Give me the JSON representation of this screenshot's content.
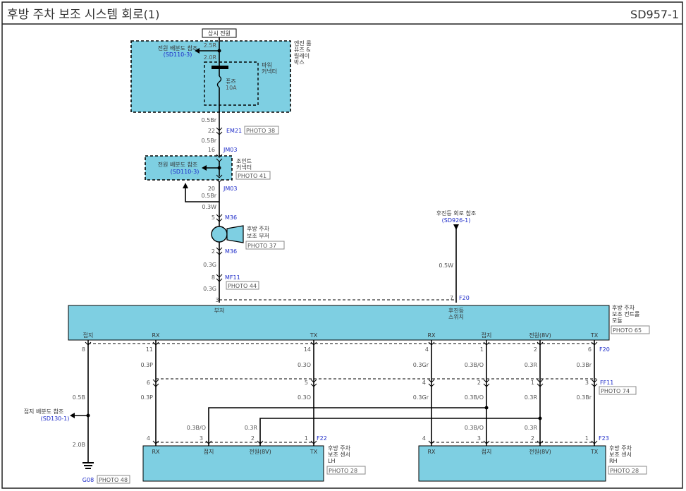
{
  "header": {
    "title": "후방 주차 보조 시스템 회로",
    "title_num": "(1)",
    "code": "SD957-1"
  },
  "top_label": "상시 전원",
  "ejb": {
    "label_lines": [
      "엔진 룸",
      "퓨즈 &",
      "릴레이",
      "박스"
    ],
    "ref_text": "전원 배분도 참조",
    "ref_code": "(SD110-3)",
    "connector_lines": [
      "파워",
      "커넥터"
    ],
    "fuse_lines": [
      "퓨즈",
      "10A"
    ],
    "wire1": "2.5R",
    "wire2": "2.0R"
  },
  "em21": {
    "wire_above": "0.5Br",
    "pin": "22",
    "code": "EM21",
    "photo": "PHOTO 38",
    "wire_below": "0.5Br"
  },
  "jm03": {
    "pin_top": "16",
    "code_top": "JM03",
    "label_lines": [
      "조인트",
      "커넥터"
    ],
    "photo": "PHOTO 41",
    "ref_text": "전원 배분도 참조",
    "ref_code": "(SD110-3)",
    "pin_bottom": "20",
    "code_bottom": "JM03",
    "wire_below": "0.5Br"
  },
  "m36": {
    "wire_above": "0.3W",
    "pin_top": "5",
    "code_top": "M36",
    "label_lines": [
      "후방 주차",
      "보조 부저"
    ],
    "photo": "PHOTO 37",
    "pin_bottom": "2",
    "code_bottom": "M36"
  },
  "mf11": {
    "wire_above": "0.3G",
    "pin": "8",
    "code": "MF11",
    "photo": "PHOTO 44",
    "wire_below": "0.3G"
  },
  "fog_ref": {
    "text": "후진등 회로 참조",
    "code": "(SD926-1)",
    "wire": "0.5W"
  },
  "module": {
    "label_lines": [
      "후방 주차",
      "보조 컨트롤",
      "모듈"
    ],
    "photo": "PHOTO 65",
    "buzzer_label": "부저",
    "buzzer_pin": "3",
    "reverse_lines": [
      "후진등",
      "스위치"
    ],
    "reverse_pin": "7",
    "reverse_code": "F20",
    "bottom_code": "F20",
    "pins": [
      {
        "label": "접지",
        "num": "8"
      },
      {
        "label": "RX",
        "num": "11"
      },
      {
        "label": "TX",
        "num": "14"
      },
      {
        "label": "RX",
        "num": "4"
      },
      {
        "label": "접지",
        "num": "1"
      },
      {
        "label": "전원(8V)",
        "num": "2"
      },
      {
        "label": "TX",
        "num": "6"
      }
    ]
  },
  "ff11": {
    "code": "FF11",
    "photo": "PHOTO 74",
    "wires_above": [
      "0.3P",
      "0.3O",
      "0.3Gr",
      "0.3B/O",
      "0.3R",
      "0.3Br"
    ],
    "pins": [
      "6",
      "5",
      "4",
      "2",
      "1",
      "3"
    ],
    "wires_below": [
      "0.3P",
      "0.3O",
      "0.3Gr",
      "0.3B/O",
      "0.3R",
      "0.3Br"
    ]
  },
  "ground": {
    "wire_above": "0.5B",
    "wire_below": "2.0B",
    "ref_text": "접지 배분도 참조",
    "ref_code": "(SD130-1)",
    "code": "G08",
    "photo": "PHOTO 48"
  },
  "sensor_lh": {
    "code": "F22",
    "label_lines": [
      "후방 주차",
      "보조 센서",
      "LH"
    ],
    "photo": "PHOTO 28",
    "gnd_wire": "0.3B/O",
    "pwr_wire": "0.3R",
    "pins": [
      {
        "label": "RX",
        "num": "4"
      },
      {
        "label": "접지",
        "num": "3"
      },
      {
        "label": "전원(8V)",
        "num": "2"
      },
      {
        "label": "TX",
        "num": "1"
      }
    ]
  },
  "sensor_rh": {
    "code": "F23",
    "label_lines": [
      "후방 주차",
      "보조 센서",
      "RH"
    ],
    "photo": "PHOTO 28",
    "gnd_wire": "0.3B/O",
    "pwr_wire": "0.3R",
    "pins": [
      {
        "label": "RX",
        "num": "4"
      },
      {
        "label": "접지",
        "num": "3"
      },
      {
        "label": "전원(8V)",
        "num": "2"
      },
      {
        "label": "TX",
        "num": "1"
      }
    ]
  }
}
